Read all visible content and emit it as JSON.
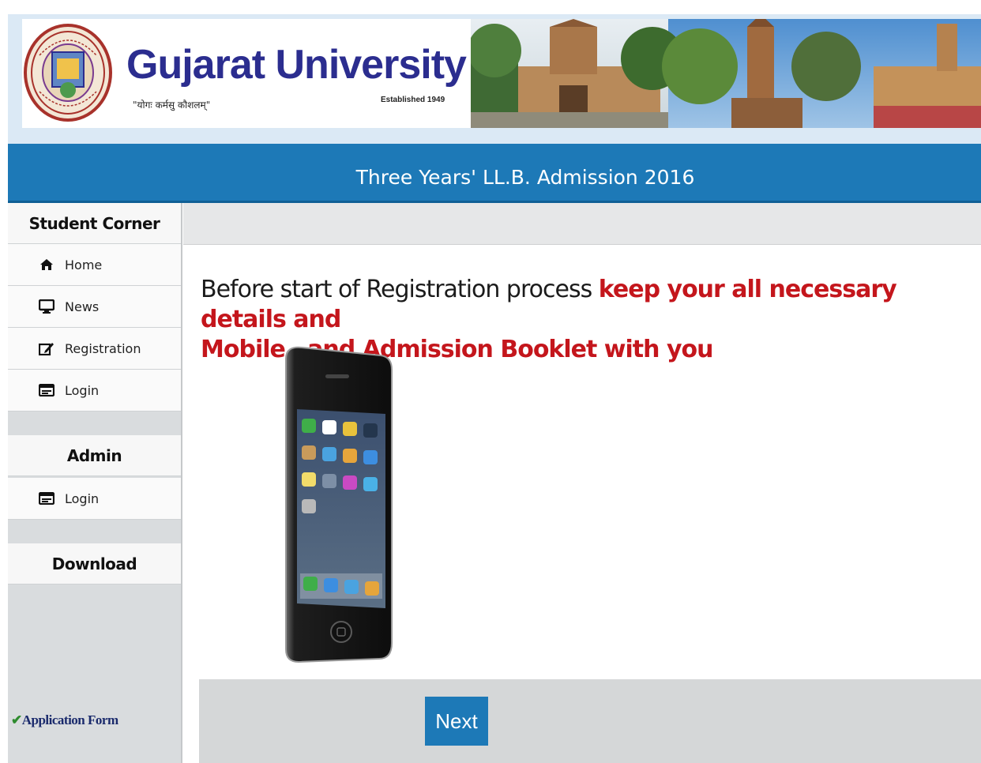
{
  "header": {
    "university_name": "Gujarat University",
    "motto": "\"योगः कर्मसु कौशलम्\"",
    "established": "Established 1949",
    "seal_icon": "university-seal-icon",
    "campus_photo": "campus-buildings-photo"
  },
  "title_bar": {
    "title": "Three Years' LL.B. Admission 2016",
    "color": "#1d79b7"
  },
  "sidebar": {
    "student_corner": {
      "heading": "Student Corner",
      "items": [
        {
          "label": "Home",
          "icon": "home-icon"
        },
        {
          "label": "News",
          "icon": "monitor-icon"
        },
        {
          "label": "Registration",
          "icon": "edit-icon"
        },
        {
          "label": "Login",
          "icon": "login-card-icon"
        }
      ]
    },
    "admin": {
      "heading": "Admin",
      "items": [
        {
          "label": "Login",
          "icon": "login-card-icon"
        }
      ]
    },
    "download": {
      "heading": "Download"
    },
    "application_form": {
      "check": "✔",
      "label": "Application Form"
    }
  },
  "main": {
    "message_plain": "Before start of Registration process ",
    "message_highlight_1": "keep your all necessary details and",
    "message_highlight_2": "Mobile   and Admission Booklet with you",
    "highlight_color": "#c4161c",
    "phone_image": "smartphone-image",
    "next_button": "Next"
  }
}
